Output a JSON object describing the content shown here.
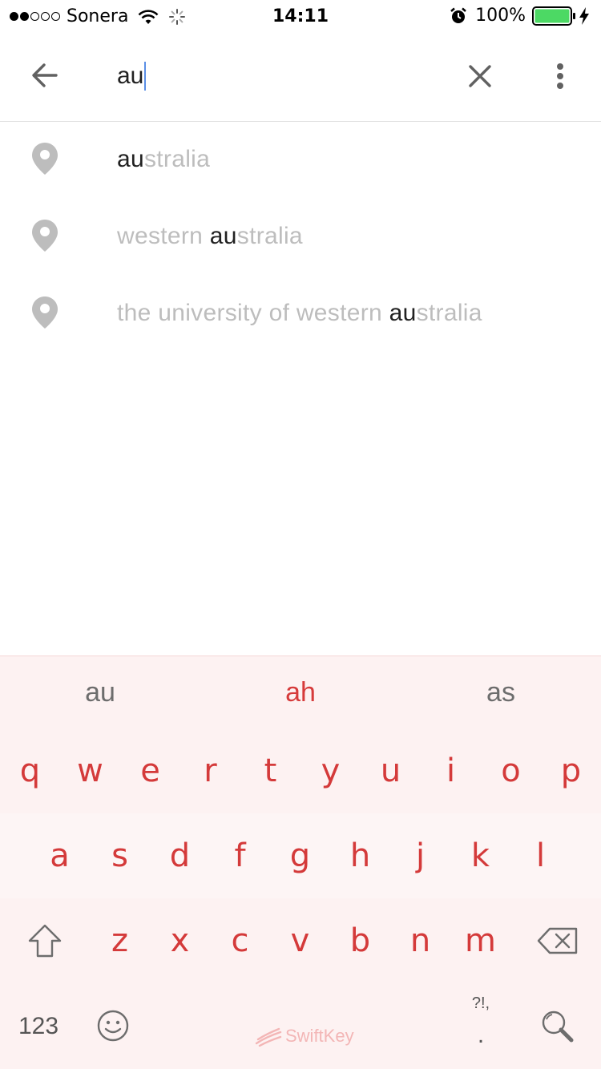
{
  "status_bar": {
    "signal_dots": [
      true,
      true,
      false,
      false,
      false
    ],
    "carrier": "Sonera",
    "time": "14:11",
    "battery_percent": "100%",
    "battery_level": 1.0,
    "icons": [
      "wifi-icon",
      "activity-spinner-icon",
      "alarm-clock-icon",
      "battery-icon",
      "charging-bolt-icon"
    ]
  },
  "search": {
    "query": "au",
    "icons": {
      "back": "arrow-left-icon",
      "clear": "close-icon",
      "more": "more-vert-icon"
    }
  },
  "suggestions": [
    {
      "before": "",
      "match": "au",
      "after": "stralia",
      "icon": "location-pin-icon"
    },
    {
      "before": "western ",
      "match": "au",
      "after": "stralia",
      "icon": "location-pin-icon"
    },
    {
      "before": "the university of western ",
      "match": "au",
      "after": "stralia",
      "icon": "location-pin-icon"
    }
  ],
  "keyboard": {
    "predictions": [
      "au",
      "ah",
      "as"
    ],
    "rows": [
      [
        "q",
        "w",
        "e",
        "r",
        "t",
        "y",
        "u",
        "i",
        "o",
        "p"
      ],
      [
        "a",
        "s",
        "d",
        "f",
        "g",
        "h",
        "j",
        "k",
        "l"
      ],
      [
        "z",
        "x",
        "c",
        "v",
        "b",
        "n",
        "m"
      ]
    ],
    "numbers_label": "123",
    "punct_label": "?!,",
    "punct_dot": ".",
    "brand": "SwiftKey",
    "icons": [
      "shift-icon",
      "backspace-icon",
      "emoji-icon",
      "search-icon"
    ]
  },
  "colors": {
    "key_text": "#d43a3a",
    "keyboard_bg": "#fdf2f2",
    "suggestion_text": "#bdbdbd",
    "match_text": "#212121",
    "caret": "#5b8fe6",
    "battery_fill": "#4cd964"
  }
}
